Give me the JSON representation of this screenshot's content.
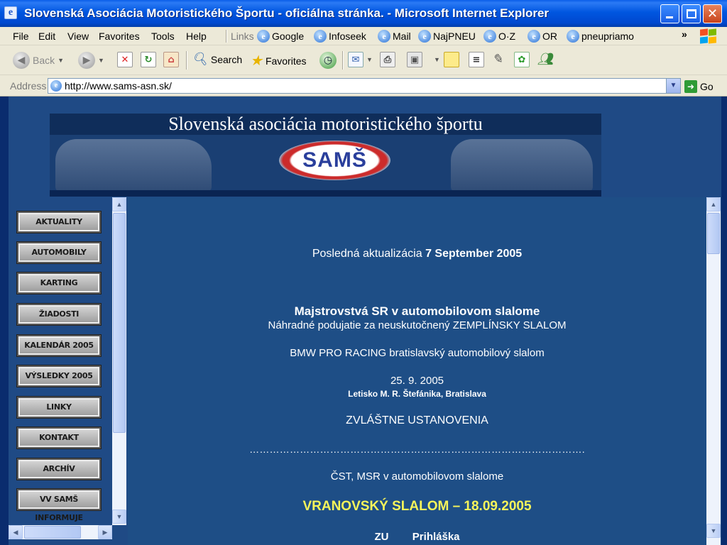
{
  "window": {
    "title": "Slovenská Asociácia Motoristického Športu - oficiálna stránka. - Microsoft Internet Explorer"
  },
  "menubar": {
    "items": [
      "File",
      "Edit",
      "View",
      "Favorites",
      "Tools",
      "Help"
    ],
    "links_label": "Links",
    "links": [
      "Google",
      "Infoseek",
      "Mail",
      "NajPNEU",
      "O·Z",
      "OR",
      "pneupriamo"
    ],
    "more": "»"
  },
  "toolbar": {
    "back": "Back",
    "search": "Search",
    "favorites": "Favorites"
  },
  "address": {
    "label": "Address",
    "url": "http://www.sams-asn.sk/",
    "go": "Go"
  },
  "banner": {
    "title": "Slovenská asociácia motoristického športu",
    "logo_text": "SAMŠ"
  },
  "nav": [
    "AKTUALITY",
    "AUTOMOBILY",
    "KARTING",
    "ŽIADOSTI",
    "KALENDÁR 2005",
    "VÝSLEDKY 2005",
    "LINKY",
    "KONTAKT",
    "ARCHÍV",
    "VV SAMŠ INFORMUJE"
  ],
  "content": {
    "update_label": "Posledná aktualizácia",
    "update_date": "7 September 2005",
    "heading": "Majstrovstvá SR v automobilovom slalome",
    "subheading": "Náhradné podujatie za neuskutočnený ZEMPLÍNSKY SLALOM",
    "event": "BMW PRO RACING bratislavský automobilový slalom",
    "date": "25. 9. 2005",
    "location": "Letisko M. R. Štefánika, Bratislava",
    "special": "ZVLÁŠTNE USTANOVENIA",
    "dots": "……………………………………………………………………………………….",
    "cst": "ČST, MSR v automobilovom slalome",
    "vranov": "VRANOVSKÝ  SLALOM – 18.09.2005",
    "zu": "ZU        Prihláška"
  }
}
